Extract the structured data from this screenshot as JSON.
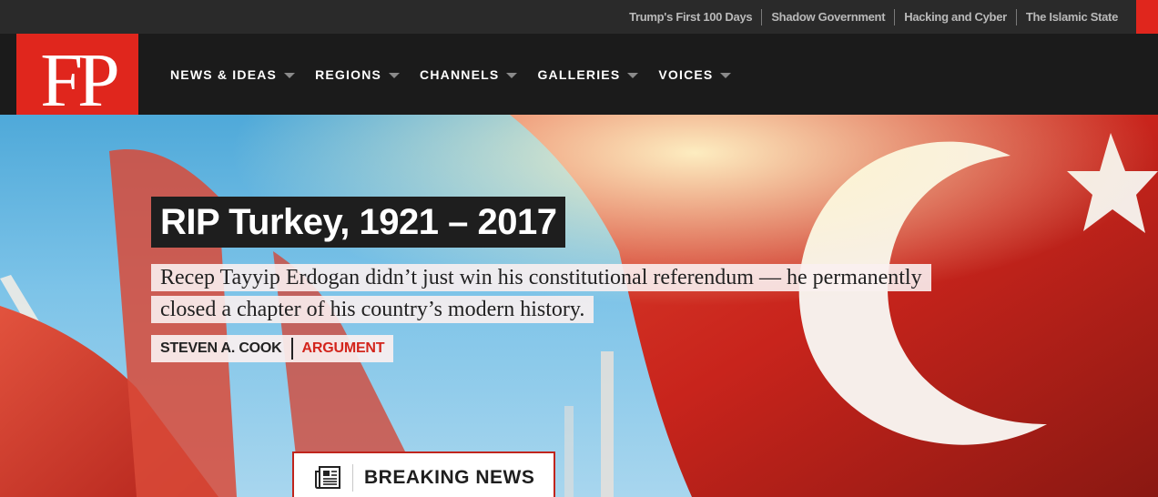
{
  "topbar": {
    "links": [
      "Trump's First 100 Days",
      "Shadow Government",
      "Hacking and Cyber",
      "The Islamic State"
    ]
  },
  "logo": {
    "text": "FP"
  },
  "nav": {
    "items": [
      "NEWS & IDEAS",
      "REGIONS",
      "CHANNELS",
      "GALLERIES",
      "VOICES"
    ]
  },
  "hero": {
    "headline": "RIP Turkey, 1921 – 2017",
    "dek_line1": "Recep Tayyip Erdogan didn’t just win his constitutional referendum — he permanently",
    "dek_line2": "closed a chapter of his country’s modern history.",
    "author": "STEVEN A. COOK",
    "kicker": "ARGUMENT"
  },
  "breaking": {
    "label": "BREAKING NEWS",
    "icon": "newspaper-icon"
  },
  "colors": {
    "brand_red": "#e0261d",
    "kicker_red": "#d3251c",
    "nav_bg": "#1b1b1b",
    "topbar_bg": "#2a2a2a"
  }
}
